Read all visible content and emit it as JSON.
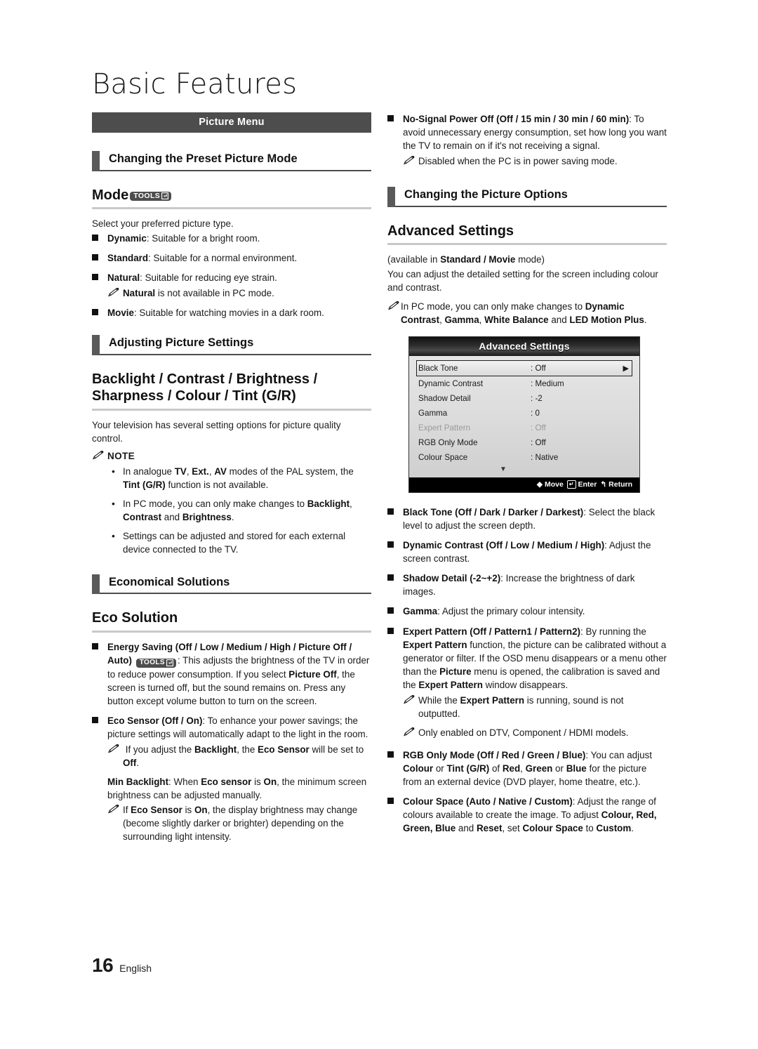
{
  "page": {
    "title": "Basic Features",
    "footer_number": "16",
    "footer_language": "English"
  },
  "colors": {
    "banner_bg": "#4d4d4d",
    "tab_bg": "#595959",
    "rule_gray": "#c9c9c9",
    "osd_header_bg": "#1b1b1b",
    "osd_body_bg": "#dcdcdc",
    "osd_footer_bg": "#000000"
  },
  "left_column": {
    "banner": "Picture Menu",
    "subhead_1": "Changing the Preset Picture Mode",
    "mode": {
      "heading": "Mode",
      "tools_badge": "TOOLS",
      "intro": "Select your preferred picture type.",
      "items": [
        {
          "term": "Dynamic",
          "desc": ": Suitable for a bright room."
        },
        {
          "term": "Standard",
          "desc": ": Suitable for a normal environment."
        },
        {
          "term": "Natural",
          "desc": ": Suitable for reducing eye strain."
        },
        {
          "term": "Movie",
          "desc": ": Suitable for watching movies in a dark room."
        }
      ],
      "natural_note": "Natural is not available in PC mode."
    },
    "subhead_2": "Adjusting Picture Settings",
    "backlight": {
      "heading_line1": "Backlight / Contrast / Brightness /",
      "heading_line2": "Sharpness / Colour / Tint (G/R)",
      "intro": "Your television has several setting options for picture quality control.",
      "note_label": "NOTE",
      "notes": [
        "In analogue TV, Ext., AV modes of the PAL system, the Tint (G/R) function is not available.",
        "In PC mode, you can only make changes to Backlight, Contrast and Brightness.",
        "Settings can be adjusted and stored for each external device connected to the TV."
      ]
    },
    "subhead_3": "Economical Solutions",
    "eco": {
      "heading": "Eco Solution",
      "energy_saving_term": "Energy Saving (Off / Low / Medium / High / Picture Off / Auto)",
      "energy_saving_badge": "TOOLS",
      "energy_saving_desc": ": This adjusts the brightness of the TV in order to reduce power consumption. If you select Picture Off, the screen is turned off, but the sound remains on. Press any button except volume button to turn on the screen.",
      "eco_sensor_term": "Eco Sensor (Off / On)",
      "eco_sensor_desc": ": To enhance your power savings; the picture settings will automatically adapt to the light in the room.",
      "eco_sensor_note": "If you adjust the Backlight, the Eco Sensor will be set to Off.",
      "min_backlight_term": "Min Backlight",
      "min_backlight_desc": ": When Eco sensor is On, the minimum screen brightness can be adjusted manually.",
      "min_backlight_note": "If Eco Sensor is On, the display brightness may change (become slightly darker or brighter) depending on the surrounding light intensity."
    }
  },
  "right_column": {
    "no_signal": {
      "term": "No-Signal Power Off (Off / 15 min / 30 min / 60 min)",
      "desc": ": To avoid unnecessary energy consumption, set how long you want the TV to remain on if it's not receiving a signal.",
      "note": "Disabled when the PC is in power saving mode."
    },
    "subhead_1": "Changing the Picture Options",
    "advanced": {
      "heading": "Advanced Settings",
      "availability": "(available in Standard / Movie mode)",
      "intro": "You can adjust the detailed setting for the screen including colour and contrast.",
      "pc_note": "In PC mode, you can only make changes to Dynamic Contrast, Gamma, White Balance and LED Motion Plus."
    },
    "osd": {
      "title": "Advanced Settings",
      "rows": [
        {
          "label": "Black Tone",
          "value": ": Off",
          "selected": true,
          "dimmed": false,
          "arrow": "▶"
        },
        {
          "label": "Dynamic Contrast",
          "value": ": Medium",
          "selected": false,
          "dimmed": false,
          "arrow": ""
        },
        {
          "label": "Shadow Detail",
          "value": ": -2",
          "selected": false,
          "dimmed": false,
          "arrow": ""
        },
        {
          "label": "Gamma",
          "value": ": 0",
          "selected": false,
          "dimmed": false,
          "arrow": ""
        },
        {
          "label": "Expert Pattern",
          "value": ": Off",
          "selected": false,
          "dimmed": true,
          "arrow": ""
        },
        {
          "label": "RGB Only Mode",
          "value": ": Off",
          "selected": false,
          "dimmed": false,
          "arrow": ""
        },
        {
          "label": "Colour Space",
          "value": ": Native",
          "selected": false,
          "dimmed": false,
          "arrow": ""
        }
      ],
      "scroll_down_glyph": "▼",
      "footer": {
        "move": "Move",
        "enter": "Enter",
        "return": "Return"
      }
    },
    "options": [
      {
        "term": "Black Tone (Off / Dark / Darker / Darkest)",
        "desc": ": Select the black level to adjust the screen depth."
      },
      {
        "term": "Dynamic Contrast (Off / Low / Medium / High)",
        "desc": ": Adjust the screen contrast."
      },
      {
        "term": "Shadow Detail (-2~+2)",
        "desc": ": Increase the brightness of dark images."
      },
      {
        "term": "Gamma",
        "desc": ": Adjust the primary colour intensity."
      }
    ],
    "expert_pattern": {
      "term": "Expert Pattern (Off / Pattern1 / Pattern2)",
      "desc": ": By running the Expert Pattern function, the picture can be calibrated without a generator or filter. If the OSD menu disappears or a menu other than the Picture menu is opened, the calibration is saved and the Expert Pattern window disappears.",
      "note_1": "While the Expert Pattern is running, sound is not outputted.",
      "note_2": "Only enabled on DTV, Component / HDMI models."
    },
    "rgb_only": {
      "term": "RGB Only Mode (Off / Red / Green / Blue)",
      "desc": ": You can adjust Colour or Tint (G/R) of Red, Green or Blue for the picture from an external device (DVD player, home theatre, etc.)."
    },
    "colour_space": {
      "term": "Colour Space (Auto / Native / Custom)",
      "desc": ": Adjust the range of colours available to create the image. To adjust Colour, Red, Green, Blue and Reset, set Colour Space to Custom."
    }
  }
}
